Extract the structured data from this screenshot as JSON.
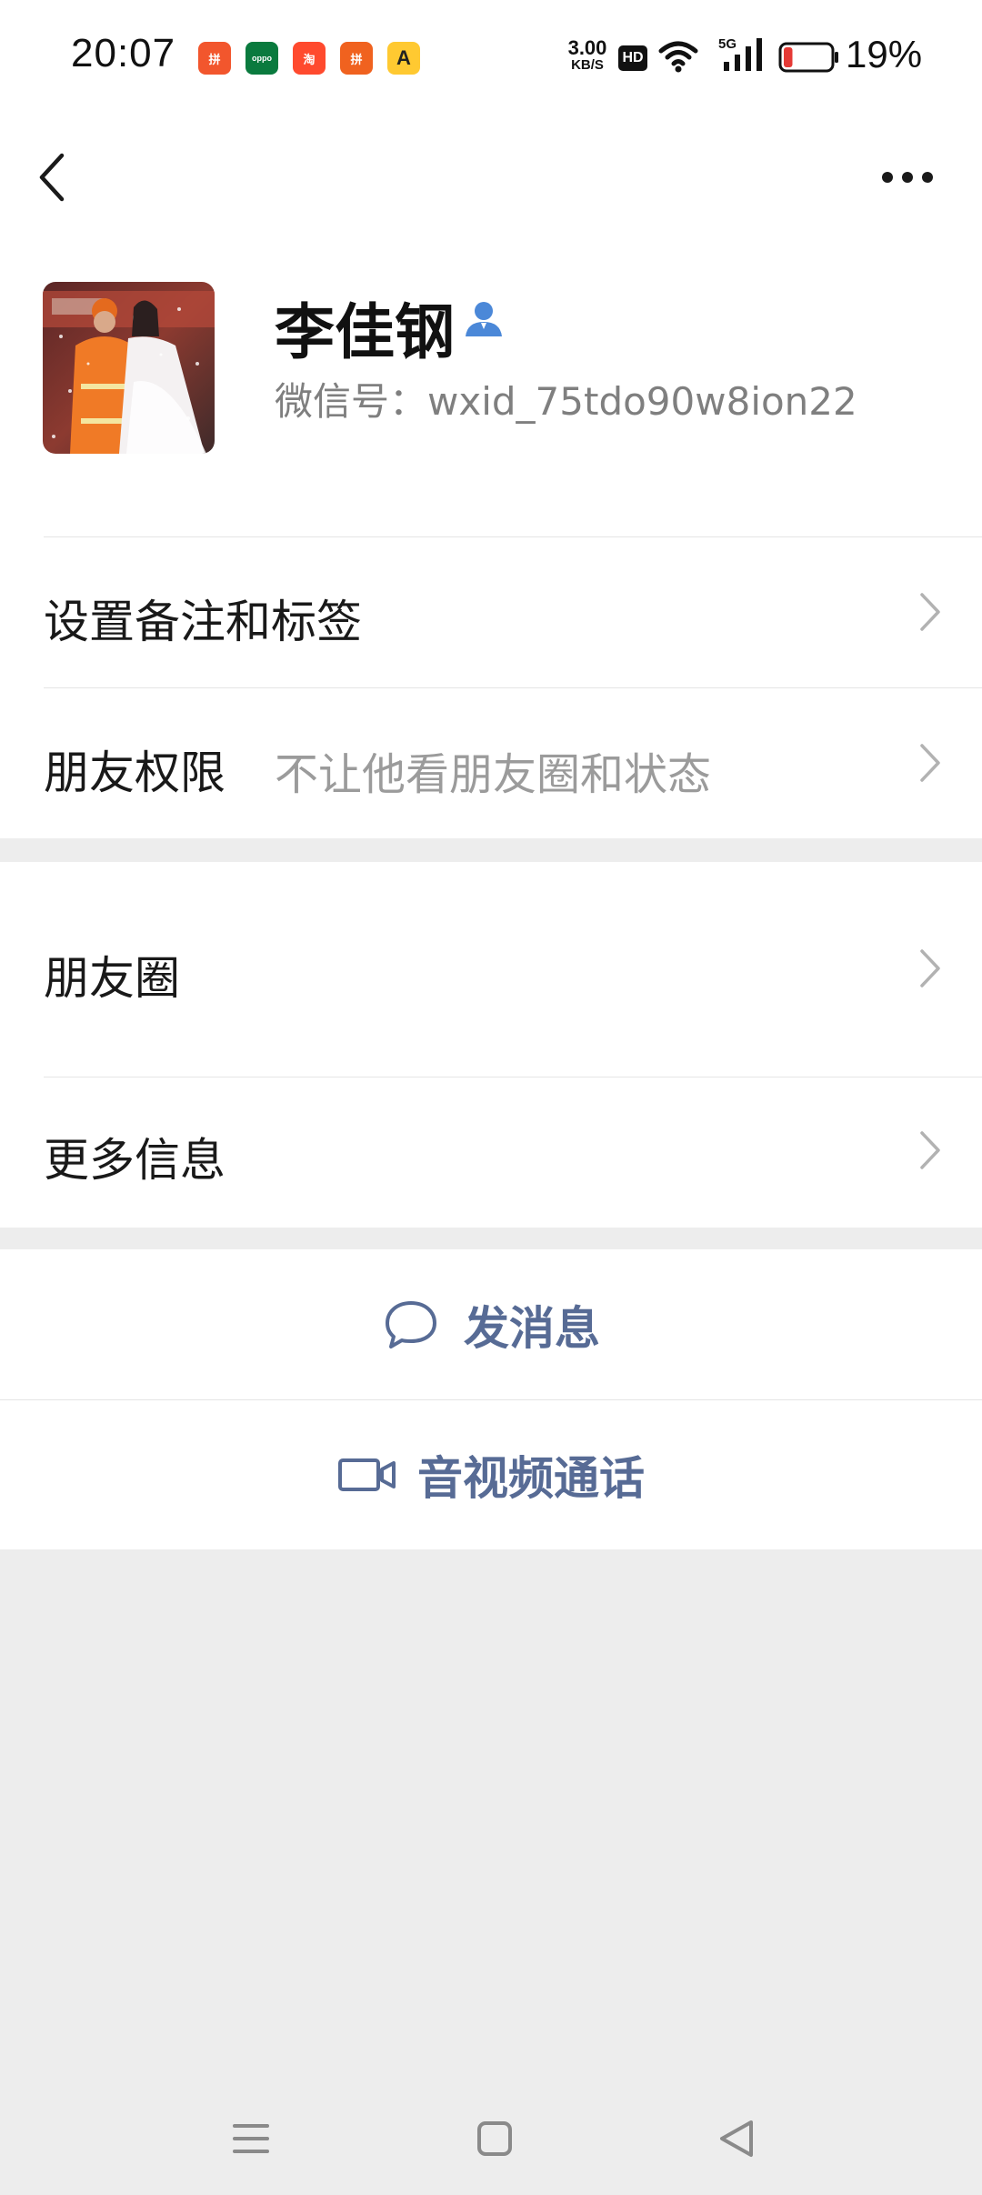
{
  "status_bar": {
    "time": "20:07",
    "notifications": [
      {
        "icon": "pinduoduo-app-icon",
        "color": "#f2562d",
        "glyph": "拼"
      },
      {
        "icon": "oppo-app-icon",
        "color": "#0a7a3e",
        "glyph": "oppo"
      },
      {
        "icon": "taobao-app-icon",
        "color": "#ff4a2e",
        "glyph": "淘"
      },
      {
        "icon": "pinduoduo-app-icon",
        "color": "#f0621f",
        "glyph": "拼"
      },
      {
        "icon": "amap-app-icon",
        "color": "#ffc931",
        "glyph": "A"
      }
    ],
    "net_speed": "3.00",
    "net_speed_unit": "KB/S",
    "hd_label": "HD",
    "network_label": "5G",
    "battery_percent": "19%",
    "battery_level": 0.19,
    "battery_color": "#e53935"
  },
  "nav": {
    "back_icon": "chevron-left-icon",
    "more_icon": "more-dots-icon"
  },
  "profile": {
    "name": "李佳钢",
    "wechat_id": "微信号：wxid_75tdo90w8ion22",
    "contact_icon": "person-icon"
  },
  "menu": {
    "remark_label": "设置备注和标签",
    "permission_label": "朋友权限",
    "permission_value": "不让他看朋友圈和状态",
    "moments_label": "朋友圈",
    "more_info_label": "更多信息"
  },
  "actions": {
    "message_label": "发消息",
    "call_label": "音视频通话",
    "link_color": "#576b95"
  }
}
